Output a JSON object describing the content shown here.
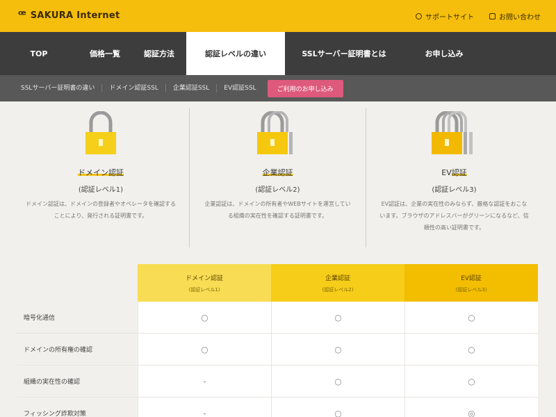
{
  "header": {
    "logo_mark": "ꟹ",
    "logo_text": "SAKURA Internet",
    "links": [
      {
        "label": "サポートサイト",
        "icon": "help-icon"
      },
      {
        "label": "お問い合わせ",
        "icon": "mail-icon"
      }
    ]
  },
  "nav": {
    "items": [
      {
        "label": "TOP",
        "active": false
      },
      {
        "label": "価格一覧",
        "active": false
      },
      {
        "label": "認証方法",
        "active": false
      },
      {
        "label": "認証レベルの違い",
        "active": true
      },
      {
        "label": "SSLサーバー証明書とは",
        "active": false
      },
      {
        "label": "お申し込み",
        "active": false
      }
    ]
  },
  "subnav": {
    "items": [
      "SSLサーバー証明書の違い",
      "ドメイン認証SSL",
      "企業認証SSL",
      "EV認証SSL"
    ],
    "cta": "ご利用のお申し込み"
  },
  "levels": [
    {
      "name": "ドメイン認証",
      "sub": "(認証レベル1)",
      "desc": "ドメイン認証は、ドメインの登録者やオペレータを確認することにより、発行される証明書です。"
    },
    {
      "name": "企業認証",
      "sub": "(認証レベル2)",
      "desc": "企業認証は、ドメインの所有者やWEBサイトを運営している組織の実在性を確認する証明書です。"
    },
    {
      "name": "EV認証",
      "sub": "(認証レベル3)",
      "desc": "EV認証は、企業の実在性のみならず、厳格な認証をおこないます。ブラウザのアドレスバーがグリーンになるなど、信頼性の高い証明書です。"
    }
  ],
  "table": {
    "headers": [
      {
        "title": "ドメイン認証",
        "sub": "(認証レベル1)"
      },
      {
        "title": "企業認証",
        "sub": "(認証レベル2)"
      },
      {
        "title": "EV認証",
        "sub": "(認証レベル3)"
      }
    ],
    "rows": [
      {
        "label": "暗号化通信",
        "values": [
          "○",
          "○",
          "○"
        ]
      },
      {
        "label": "ドメインの所有権の確認",
        "values": [
          "○",
          "○",
          "○"
        ]
      },
      {
        "label": "組織の実在性の確認",
        "values": [
          "-",
          "○",
          "○"
        ]
      },
      {
        "label": "フィッシング詐欺対策",
        "values": [
          "-",
          "○",
          "◎"
        ]
      }
    ]
  },
  "colors": {
    "brand_yellow": "#f5be0c",
    "nav_dark": "#3d3d3d",
    "cta_pink": "#de5a7c"
  }
}
